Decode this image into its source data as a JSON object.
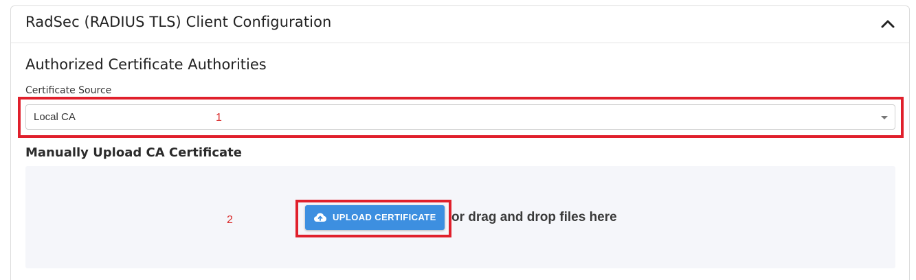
{
  "panel": {
    "title": "RadSec (RADIUS TLS) Client Configuration",
    "collapse_icon": "chevron-up-icon"
  },
  "ca_section": {
    "title": "Authorized Certificate Authorities",
    "certificate_source": {
      "label": "Certificate Source",
      "selected": "Local CA"
    }
  },
  "upload_section": {
    "title": "Manually Upload CA Certificate",
    "button_label": "UPLOAD CERTIFICATE",
    "button_icon": "cloud-upload-icon",
    "drag_text": "or drag and drop files here"
  },
  "annotations": {
    "box_1_number": "1",
    "box_2_number": "2",
    "color": "#e0202c"
  },
  "colors": {
    "accent": "#3d8fe0",
    "dropzone_bg": "#f5f6fa"
  }
}
